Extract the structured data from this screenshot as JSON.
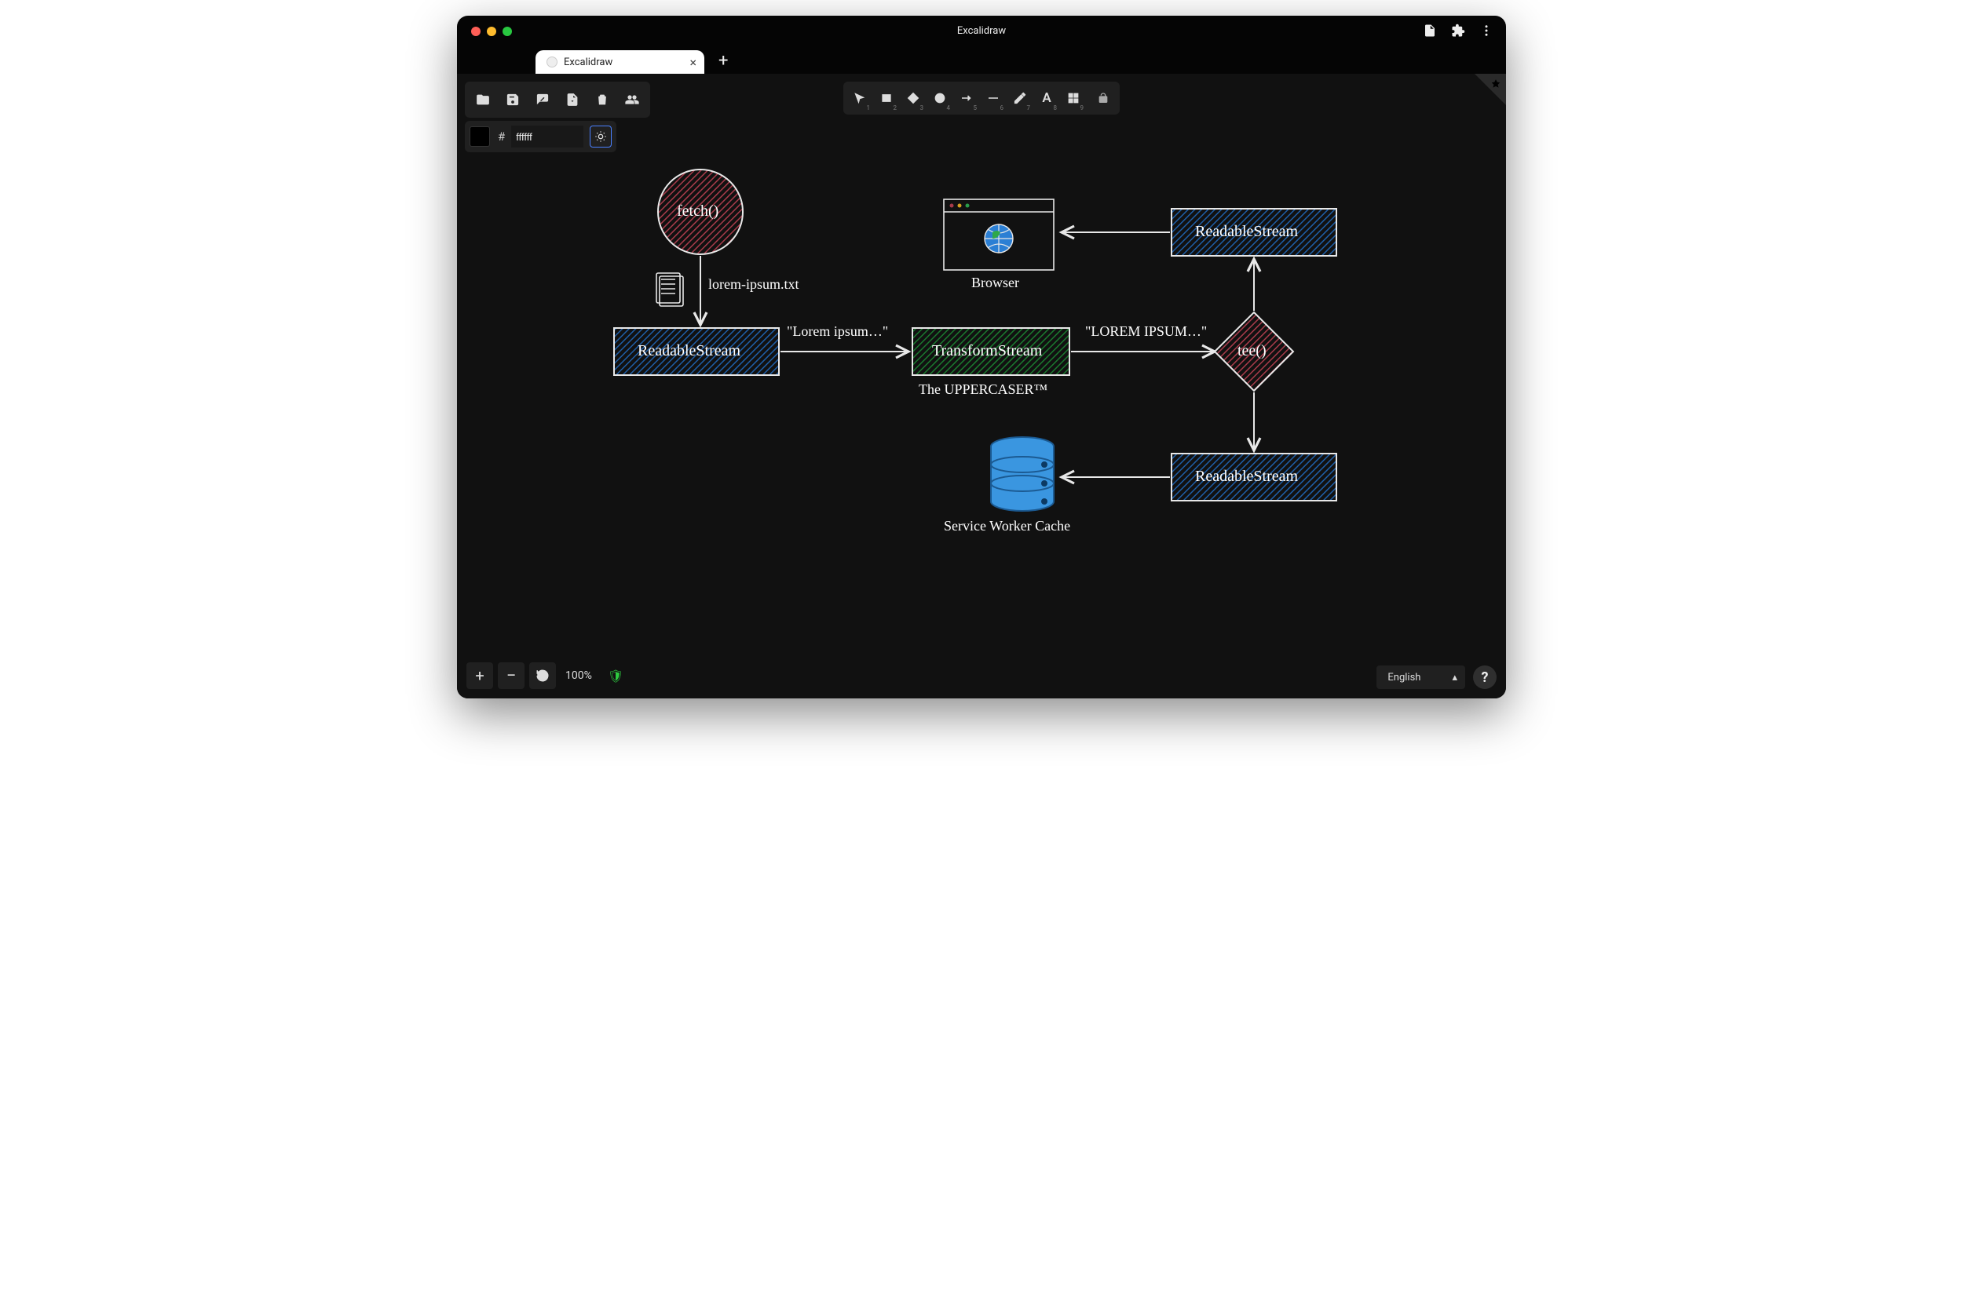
{
  "window": {
    "title": "Excalidraw"
  },
  "tab": {
    "label": "Excalidraw"
  },
  "color_input": {
    "value": "ffffff",
    "prefix": "#"
  },
  "tool_numbers": {
    "select": "1",
    "rect": "2",
    "diamond": "3",
    "circle": "4",
    "arrow": "5",
    "line": "6",
    "draw": "7",
    "text": "8",
    "image": "9"
  },
  "zoom": {
    "label": "100%"
  },
  "language": {
    "selected": "English"
  },
  "diagram": {
    "fetch": "fetch()",
    "filename": "lorem-ipsum.txt",
    "readable1": "ReadableStream",
    "lorem": "\"Lorem ipsum…\"",
    "transform": "TransformStream",
    "uppercaser": "The UPPERCASER™",
    "LOREM": "\"LOREM IPSUM…\"",
    "tee": "tee()",
    "readable2": "ReadableStream",
    "browser": "Browser",
    "readable3": "ReadableStream",
    "swcache": "Service Worker Cache"
  }
}
